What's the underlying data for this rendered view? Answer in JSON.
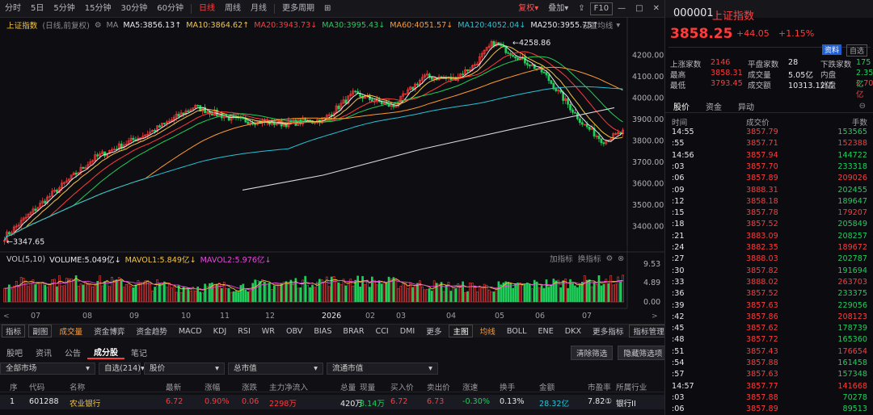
{
  "toolbar": {
    "periods": [
      "分时",
      "5日",
      "5分钟",
      "15分钟",
      "30分钟",
      "60分钟",
      "日线",
      "周线",
      "月线",
      "更多周期"
    ],
    "active": "日线",
    "right": [
      "复权",
      "叠加",
      "F10"
    ]
  },
  "chart": {
    "title": "上证指数",
    "subtitle": "(日线,前复权)",
    "ma_label": "MA",
    "ma": [
      {
        "t": "MA5:3856.13",
        "c": "#e8e8ea",
        "a": "↑"
      },
      {
        "t": "MA10:3864.62",
        "c": "#f5c542",
        "a": "↑"
      },
      {
        "t": "MA20:3943.73",
        "c": "#ff3b3b",
        "a": "↓"
      },
      {
        "t": "MA30:3995.43",
        "c": "#1ecf5a",
        "a": "↓"
      },
      {
        "t": "MA60:4051.57",
        "c": "#ff9a2e",
        "a": "↓"
      },
      {
        "t": "MA120:4052.04",
        "c": "#24c3d6",
        "a": "↓"
      },
      {
        "t": "MA250:3955.75",
        "c": "#e8e8ea",
        "a": "↑"
      }
    ],
    "settings": "设置均线",
    "price_ticks": [
      "4200.00",
      "4100.00",
      "4000.00",
      "3900.00",
      "3800.00",
      "3700.00",
      "3600.00",
      "3500.00",
      "3400.00"
    ],
    "high_label": "4258.86",
    "low_label": "3347.65",
    "vol": [
      {
        "t": "VOL(5,10)",
        "c": "#c8c8cc"
      },
      {
        "t": "VOLUME:5.049亿",
        "c": "#e8e8ea",
        "a": "↓"
      },
      {
        "t": "MAVOL1:5.849亿",
        "c": "#f5c542",
        "a": "↓"
      },
      {
        "t": "MAVOL2:5.976亿",
        "c": "#e24bd8",
        "a": "↓"
      }
    ],
    "vol_tools": [
      "加指标",
      "换指标"
    ],
    "vol_ticks": [
      "9.53",
      "4.89",
      "0.00"
    ],
    "months": [
      "07",
      "08",
      "09",
      "10",
      "11",
      "12",
      "2026",
      "02",
      "03",
      "04",
      "05",
      "06",
      "07"
    ]
  },
  "indicators": {
    "left": [
      "指标",
      "副图",
      "成交量",
      "资金博弈",
      "资金趋势",
      "MACD",
      "KDJ",
      "RSI",
      "WR",
      "OBV",
      "BIAS",
      "BRAR",
      "CCI",
      "DMI",
      "更多"
    ],
    "main": "主图",
    "main_items": [
      "均线",
      "BOLL",
      "ENE",
      "DKX",
      "更多指标"
    ],
    "manage": "指标管理"
  },
  "list": {
    "tabs": [
      "股吧",
      "资讯",
      "公告",
      "成分股",
      "笔记"
    ],
    "active_tab": "成分股",
    "buttons": [
      "清除筛选",
      "隐藏筛选项"
    ],
    "filters": [
      "全部市场",
      "自选(214)",
      "股价",
      "总市值",
      "流通市值"
    ],
    "headers": [
      "序",
      "代码",
      "名称",
      "最新",
      "涨幅",
      "涨跌",
      "主力净流入",
      "总量",
      "现量",
      "买入价",
      "卖出价",
      "涨速",
      "换手",
      "金额",
      "市盈率",
      "所属行业"
    ],
    "row": [
      "1",
      "601288",
      "农业银行",
      "6.72",
      "0.90%",
      "0.06",
      "2298万",
      "420万",
      "8.14万",
      "6.72",
      "6.73",
      "-0.30%",
      "0.13%",
      "28.32亿",
      "7.82①",
      "银行II"
    ]
  },
  "right": {
    "code": "000001",
    "name": "上证指数",
    "price": "3858.25",
    "change": "+44.05",
    "pct": "+1.15%",
    "badge1": "资料",
    "badge2": "自选",
    "stats": [
      [
        "上涨家数",
        "2146",
        "平盘家数",
        "28",
        "下跌家数",
        "175"
      ],
      [
        "最高",
        "3858.31",
        "成交量",
        "5.05亿",
        "内盘",
        "2.35亿"
      ],
      [
        "最低",
        "3793.45",
        "成交额",
        "10313.12亿",
        "外盘",
        "2.70亿"
      ]
    ],
    "tabs": [
      "股价",
      "资金",
      "异动"
    ],
    "tick_headers": [
      "时间",
      "成交价",
      "手数"
    ],
    "ticks": [
      [
        "14:55",
        "3857.79",
        "153565"
      ],
      [
        ":55",
        "3857.71",
        "152388"
      ],
      [
        "14:56",
        "3857.94",
        "144722"
      ],
      [
        ":03",
        "3857.70",
        "233318"
      ],
      [
        ":06",
        "3857.89",
        "209026"
      ],
      [
        ":09",
        "3888.31",
        "202455"
      ],
      [
        ":12",
        "3858.18",
        "189647"
      ],
      [
        ":15",
        "3857.78",
        "179207"
      ],
      [
        ":18",
        "3857.52",
        "205849"
      ],
      [
        ":21",
        "3883.09",
        "208257"
      ],
      [
        ":24",
        "3882.35",
        "189672"
      ],
      [
        ":27",
        "3888.03",
        "202787"
      ],
      [
        ":30",
        "3857.82",
        "191694"
      ],
      [
        ":33",
        "3888.02",
        "263703"
      ],
      [
        ":36",
        "3857.52",
        "233375"
      ],
      [
        ":39",
        "3857.63",
        "229056"
      ],
      [
        ":42",
        "3857.86",
        "208123"
      ],
      [
        ":45",
        "3857.62",
        "178739"
      ],
      [
        ":48",
        "3857.72",
        "165360"
      ],
      [
        ":51",
        "3857.43",
        "176654"
      ],
      [
        ":54",
        "3857.88",
        "161458"
      ],
      [
        ":57",
        "3857.63",
        "157348"
      ],
      [
        "14:57",
        "3857.77",
        "141668"
      ],
      [
        ":03",
        "3857.88",
        "70278"
      ],
      [
        ":06",
        "3857.89",
        "89513"
      ]
    ]
  }
}
